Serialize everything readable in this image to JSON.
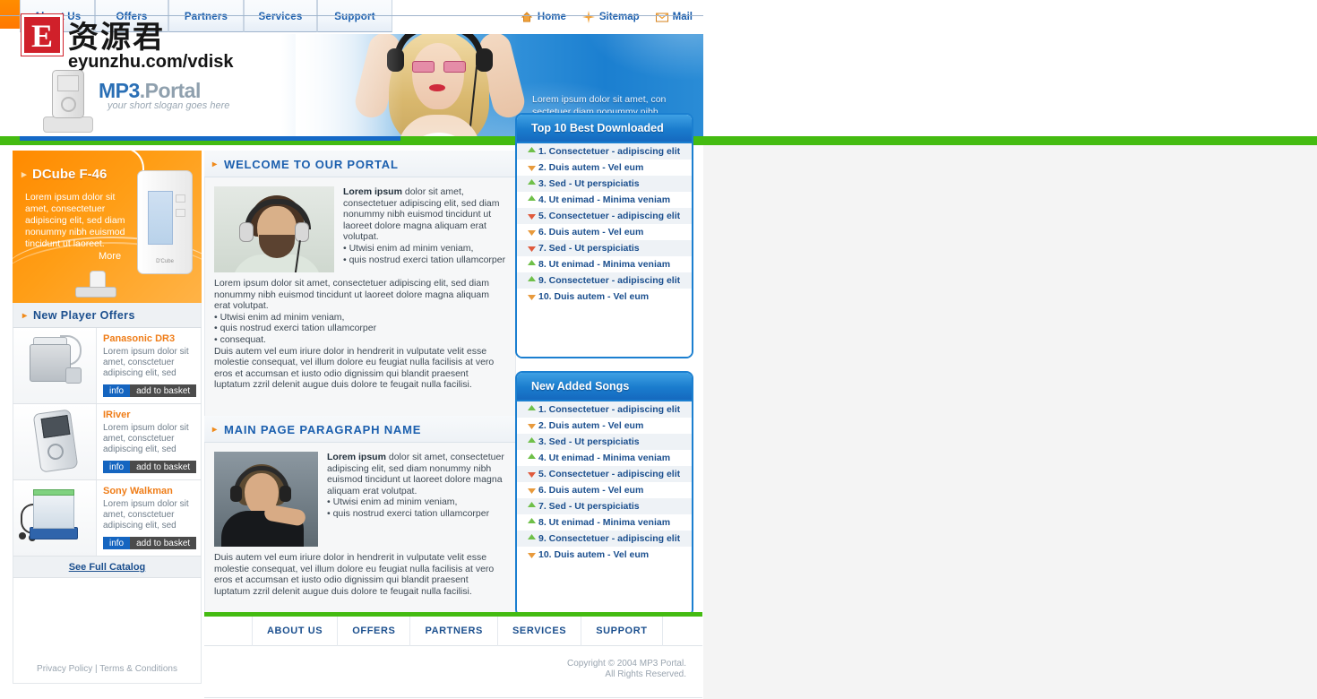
{
  "nav": {
    "tabs": [
      {
        "label": "About Us"
      },
      {
        "label": "Offers"
      },
      {
        "label": "Partners"
      },
      {
        "label": "Services"
      },
      {
        "label": "Support"
      }
    ],
    "utility": [
      {
        "label": "Home",
        "icon": "home-icon"
      },
      {
        "label": "Sitemap",
        "icon": "sitemap-icon"
      },
      {
        "label": "Mail",
        "icon": "mail-icon"
      }
    ]
  },
  "logo": {
    "badge_letter": "E",
    "cn_name": "资源君",
    "url": "eyunzhu.com/vdisk",
    "brand_main": "MP3",
    "brand_sub": ".Portal",
    "slogan": "your short slogan goes here"
  },
  "banner": {
    "text": "Lorem ipsum dolor sit amet, con sectetuer diam nonummy nibh euismod"
  },
  "promo": {
    "title": "DCube F-46",
    "body": "Lorem ipsum dolor sit amet, consectetuer adipiscing elit, sed diam nonummy nibh euismod tincidunt ut laoreet.",
    "more": "More",
    "device_label": "D'Cube"
  },
  "offers": {
    "heading": "New Player Offers",
    "items": [
      {
        "name": "Panasonic DR3",
        "desc": "Lorem ipsum dolor sit amet, consctetuer adipiscing elit, sed",
        "info": "info",
        "basket": "add to basket"
      },
      {
        "name": "IRiver",
        "desc": "Lorem ipsum dolor sit amet, consctetuer adipiscing elit, sed",
        "info": "info",
        "basket": "add to basket"
      },
      {
        "name": "Sony Walkman",
        "desc": "Lorem ipsum dolor sit amet, consctetuer adipiscing elit, sed",
        "info": "info",
        "basket": "add to basket"
      }
    ],
    "catalog_link": "See Full Catalog"
  },
  "left_legal": {
    "privacy": "Privacy Policy",
    "separator": " | ",
    "terms": "Terms & Conditions"
  },
  "panels": [
    {
      "heading": "WELCOME TO OUR PORTAL",
      "lead_bold": "Lorem ipsum",
      "lead_rest": " dolor sit amet, consectetuer adipiscing elit, sed diam nonummy nibh euismod tincidunt ut laoreet dolore magna aliquam erat volutpat.",
      "lead_bullets": "• Utwisi enim ad minim veniam,\n• quis nostrud exerci tation ullamcorper",
      "body": "Lorem ipsum dolor sit amet, consectetuer adipiscing elit, sed diam nonummy nibh euismod tincidunt ut laoreet dolore magna aliquam erat volutpat.\n• Utwisi enim ad minim veniam,\n• quis nostrud exerci tation ullamcorper\n• consequat.\nDuis autem vel eum iriure dolor in hendrerit in vulputate velit esse molestie consequat, vel illum dolore eu feugiat nulla facilisis at vero eros et accumsan et iusto odio dignissim qui blandit praesent luptatum zzril delenit augue duis dolore te feugait nulla facilisi."
    },
    {
      "heading": "MAIN PAGE PARAGRAPH NAME",
      "lead_bold": "Lorem ipsum",
      "lead_rest": " dolor sit amet, consectetuer adipiscing elit, sed diam nonummy nibh euismod tincidunt ut laoreet dolore magna aliquam erat volutpat.",
      "lead_bullets": "• Utwisi enim ad minim veniam,\n• quis nostrud exerci tation ullamcorper",
      "body": "Duis autem vel eum iriure dolor in hendrerit in vulputate velit esse molestie consequat, vel illum dolore eu feugiat nulla facilisis at vero eros et accumsan et iusto odio dignissim qui blandit praesent luptatum zzril delenit augue duis dolore te feugait nulla facilisi."
    }
  ],
  "top10": {
    "heading": "Top 10 Best Downloaded",
    "items": [
      {
        "label": "1. Consectetuer - adipiscing elit",
        "trend": "up"
      },
      {
        "label": "2. Duis autem - Vel eum",
        "trend": "down"
      },
      {
        "label": "3. Sed - Ut perspiciatis",
        "trend": "up"
      },
      {
        "label": "4. Ut enimad - Minima veniam",
        "trend": "up"
      },
      {
        "label": "5. Consectetuer - adipiscing elit",
        "trend": "down"
      },
      {
        "label": "6. Duis autem - Vel eum",
        "trend": "down"
      },
      {
        "label": "7. Sed - Ut perspiciatis",
        "trend": "down"
      },
      {
        "label": "8. Ut enimad - Minima veniam",
        "trend": "up"
      },
      {
        "label": "9. Consectetuer - adipiscing elit",
        "trend": "up"
      },
      {
        "label": "10. Duis autem - Vel eum",
        "trend": "down"
      }
    ]
  },
  "newsongs": {
    "heading": "New Added Songs",
    "items": [
      {
        "label": "1. Consectetuer - adipiscing elit",
        "trend": "up"
      },
      {
        "label": "2. Duis autem - Vel eum",
        "trend": "down"
      },
      {
        "label": "3. Sed - Ut perspiciatis",
        "trend": "up"
      },
      {
        "label": "4. Ut enimad - Minima veniam",
        "trend": "up"
      },
      {
        "label": "5. Consectetuer - adipiscing elit",
        "trend": "down"
      },
      {
        "label": "6. Duis autem - Vel eum",
        "trend": "down"
      },
      {
        "label": "7. Sed - Ut perspiciatis",
        "trend": "up"
      },
      {
        "label": "8. Ut enimad - Minima veniam",
        "trend": "up"
      },
      {
        "label": "9. Consectetuer - adipiscing elit",
        "trend": "up"
      },
      {
        "label": "10. Duis autem - Vel eum",
        "trend": "down"
      }
    ]
  },
  "footer": {
    "nav": [
      {
        "label": "ABOUT US"
      },
      {
        "label": "OFFERS"
      },
      {
        "label": "PARTNERS"
      },
      {
        "label": "SERVICES"
      },
      {
        "label": "SUPPORT"
      }
    ],
    "copyright_line1": "Copyright © 2004 MP3 Portal.",
    "copyright_line2": "All Rights Reserved."
  },
  "colors": {
    "accent_blue": "#1b7fd0",
    "accent_green": "#44bb11",
    "accent_orange": "#ff8a00",
    "link_blue": "#1b4f8e",
    "product_name": "#ef7d18"
  }
}
